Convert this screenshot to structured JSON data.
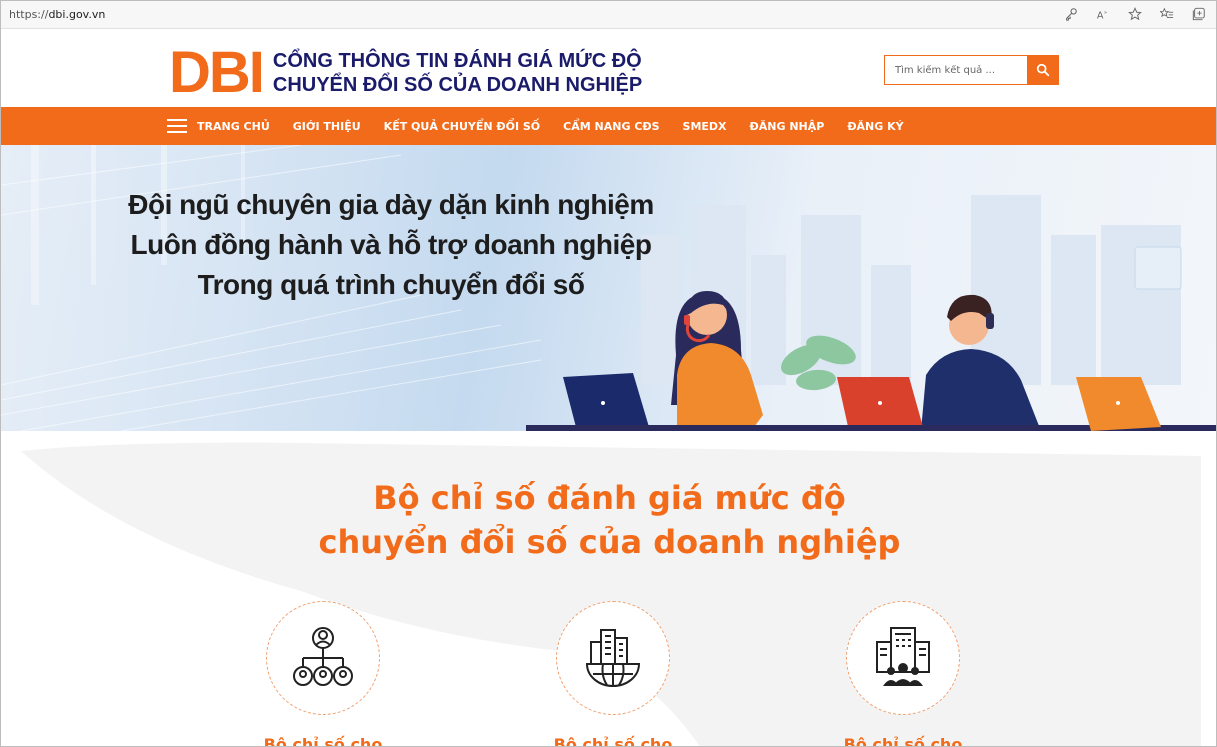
{
  "browser": {
    "url_prefix": "https://",
    "url_host": "dbi.gov.vn",
    "icons": [
      "key-icon",
      "read-aloud-icon",
      "favorite-icon",
      "favorites-list-icon",
      "collections-icon"
    ]
  },
  "header": {
    "logo_mark": "DBI",
    "logo_line1": "CỔNG THÔNG TIN ĐÁNH GIÁ MỨC ĐỘ",
    "logo_line2": "CHUYỂN ĐỔI SỐ CỦA DOANH NGHIỆP",
    "search_placeholder": "Tìm kiếm kết quả ..."
  },
  "nav": {
    "items": [
      {
        "label": "TRANG CHỦ"
      },
      {
        "label": "GIỚI THIỆU"
      },
      {
        "label": "KẾT QUẢ CHUYỂN ĐỔI SỐ"
      },
      {
        "label": "CẨM NANG CĐS"
      },
      {
        "label": "SMEDX"
      },
      {
        "label": "ĐĂNG NHẬP"
      },
      {
        "label": "ĐĂNG KÝ"
      }
    ]
  },
  "hero": {
    "lines": [
      "Đội ngũ chuyên gia dày dặn kinh nghiệm",
      "Luôn đồng hành và hỗ trợ doanh nghiệp",
      "Trong quá trình chuyển đổi số"
    ]
  },
  "section": {
    "title_line1": "Bộ chỉ số đánh giá mức độ",
    "title_line2": "chuyển đổi số của doanh nghiệp",
    "cards": [
      {
        "label": "Bộ chỉ số cho",
        "icon": "org-chart-icon"
      },
      {
        "label": "Bộ chỉ số cho",
        "icon": "city-globe-icon"
      },
      {
        "label": "Bộ chỉ số cho",
        "icon": "building-people-icon"
      }
    ]
  },
  "colors": {
    "brand_orange": "#f26b1a",
    "navy": "#1b1b6b"
  }
}
